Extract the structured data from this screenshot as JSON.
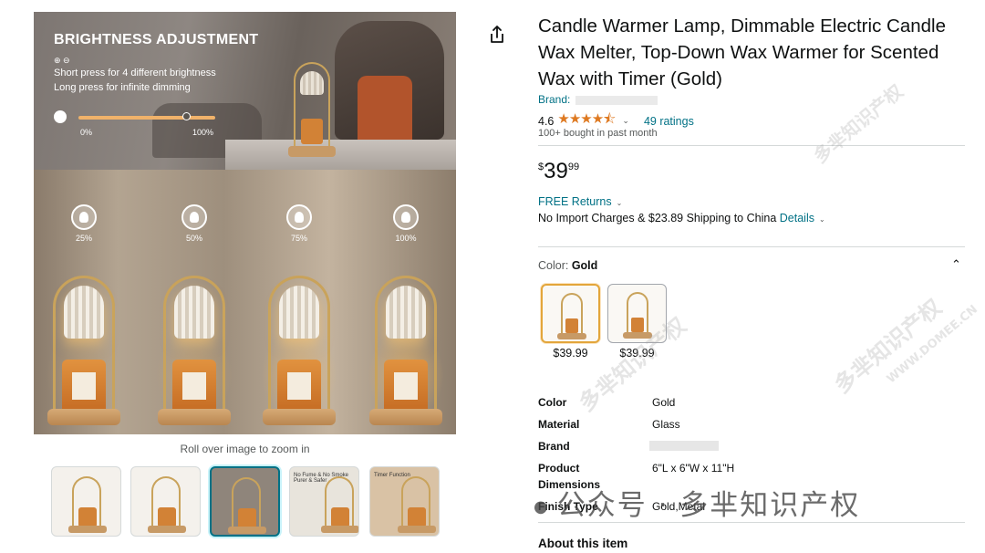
{
  "main_image": {
    "headline": "BRIGHTNESS ADJUSTMENT",
    "icons_text": "⊕ ⊖",
    "line1": "Short press for 4 different brightness",
    "line2": "Long press for infinite dimming",
    "slider_min": "0%",
    "slider_max": "100%",
    "levels": [
      "25%",
      "50%",
      "75%",
      "100%"
    ],
    "zoom_hint": "Roll over image to zoom in"
  },
  "thumbnails": [
    {
      "caption": ""
    },
    {
      "caption": ""
    },
    {
      "caption": ""
    },
    {
      "caption": "No Fume & No Smoke\nPurer & Safer"
    },
    {
      "caption": "Timer Function"
    }
  ],
  "product": {
    "title": "Candle Warmer Lamp, Dimmable Electric Candle Wax Melter, Top-Down Wax Warmer for Scented Wax with Timer (Gold)",
    "brand_label": "Brand:",
    "rating_value": "4.6",
    "stars": "★★★★⯪",
    "rating_count": "49 ratings",
    "bought": "100+ bought in past month",
    "price_symbol": "$",
    "price_whole": "39",
    "price_fraction": "99",
    "free_returns": "FREE Returns",
    "shipping_text": "No Import Charges & $23.89 Shipping to China",
    "shipping_details": "Details",
    "color_label": "Color:",
    "color_value": "Gold",
    "swatches": [
      {
        "price": "$39.99"
      },
      {
        "price": "$39.99"
      }
    ],
    "specs": [
      {
        "label": "Color",
        "value": "Gold"
      },
      {
        "label": "Material",
        "value": "Glass"
      },
      {
        "label": "Brand",
        "value": ""
      },
      {
        "label": "Product Dimensions",
        "value": "6\"L x 6\"W x 11\"H"
      },
      {
        "label": "Finish Type",
        "value": "Gold,Metal"
      }
    ],
    "about_heading": "About this item"
  },
  "watermark": {
    "main": "公众号 · 多芈知识产权",
    "faint": "多芈知识产权",
    "faint_url": "WWW.DOMEE.CN"
  },
  "colors": {
    "link": "#007185",
    "star": "#de7921",
    "selected_thumb_border": "#007185",
    "selected_swatch_border": "#e3a63b"
  },
  "icons": [
    "share-icon",
    "star-icon",
    "chevron-down-icon",
    "chevron-up-icon",
    "bulb-icon"
  ]
}
